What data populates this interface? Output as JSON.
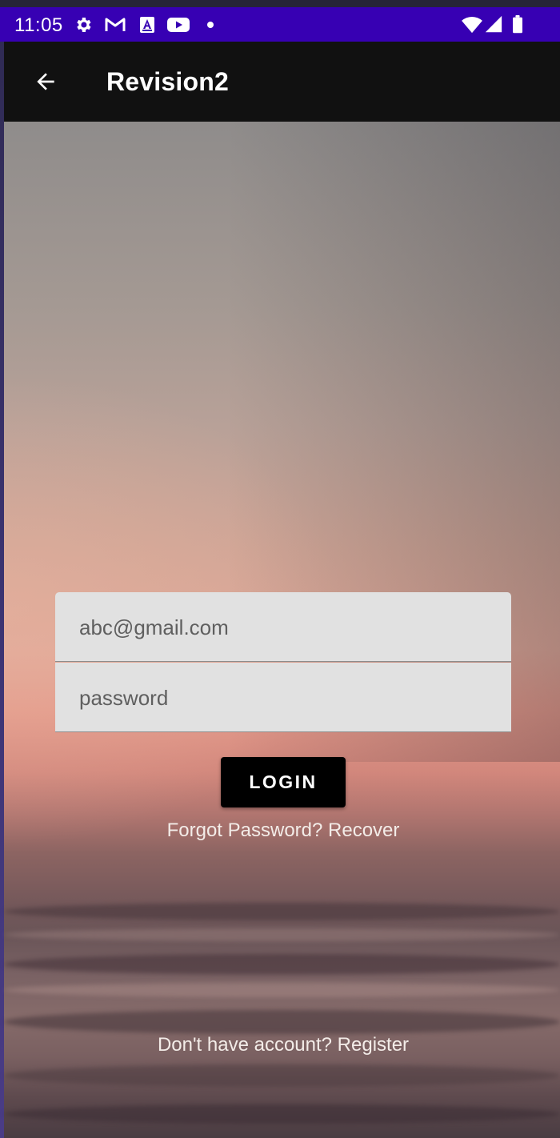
{
  "status_bar": {
    "time": "11:05",
    "background_color": "#3700b3",
    "left_icons": [
      "gear-icon",
      "gmail-icon",
      "font-a-icon",
      "youtube-icon",
      "dot-icon"
    ],
    "right_icons": [
      "wifi-icon",
      "signal-icon",
      "battery-icon"
    ]
  },
  "app_bar": {
    "title": "Revision2",
    "back_icon": "arrow-left-icon",
    "background_color": "#111111"
  },
  "login_form": {
    "email": {
      "placeholder": "abc@gmail.com",
      "value": ""
    },
    "password": {
      "placeholder": "password",
      "value": ""
    },
    "login_button_label": "LOGIN",
    "forgot_text": "Forgot Password? Recover",
    "register_text": "Don't have account? Register"
  },
  "background": {
    "description_colors": [
      "#8f8c8b",
      "#e0a898",
      "#74585a",
      "#4a3c42"
    ]
  }
}
